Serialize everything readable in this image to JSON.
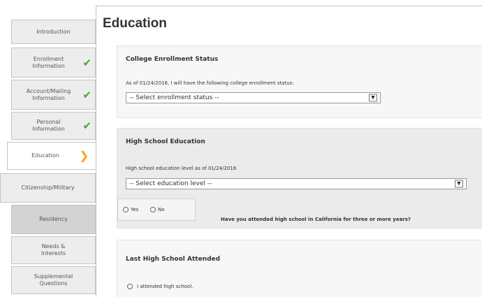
{
  "nav": {
    "items": [
      {
        "label": "Introduction"
      },
      {
        "label": "Enrollment\nInformation",
        "status": "complete"
      },
      {
        "label": "Account/Mailing\nInformation",
        "status": "complete"
      },
      {
        "label": "Personal\nInformation",
        "status": "complete"
      },
      {
        "label": "Education",
        "status": "current"
      },
      {
        "label": "Citizenship/Military"
      },
      {
        "label": "Residency"
      },
      {
        "label": "Needs &\nInterests"
      },
      {
        "label": "Supplemental\nQuestions"
      }
    ],
    "check_color": "#4da336",
    "arrow_color": "#f5a21b"
  },
  "page": {
    "title": "Education"
  },
  "college_enrollment": {
    "title": "College Enrollment Status",
    "label": "As of 01/24/2016, I will have the following college enrollment status:",
    "select_value": "-- Select enrollment status --"
  },
  "high_school": {
    "title": "High School Education",
    "label": "High school education level as of 01/24/2016",
    "select_value": "-- Select education level --",
    "options": {
      "yes": "Yes",
      "no": "No"
    },
    "question": "Have you attended high school in California for three or more years?"
  },
  "last_high_school": {
    "title": "Last High School Attended",
    "option": "I attended high school."
  }
}
